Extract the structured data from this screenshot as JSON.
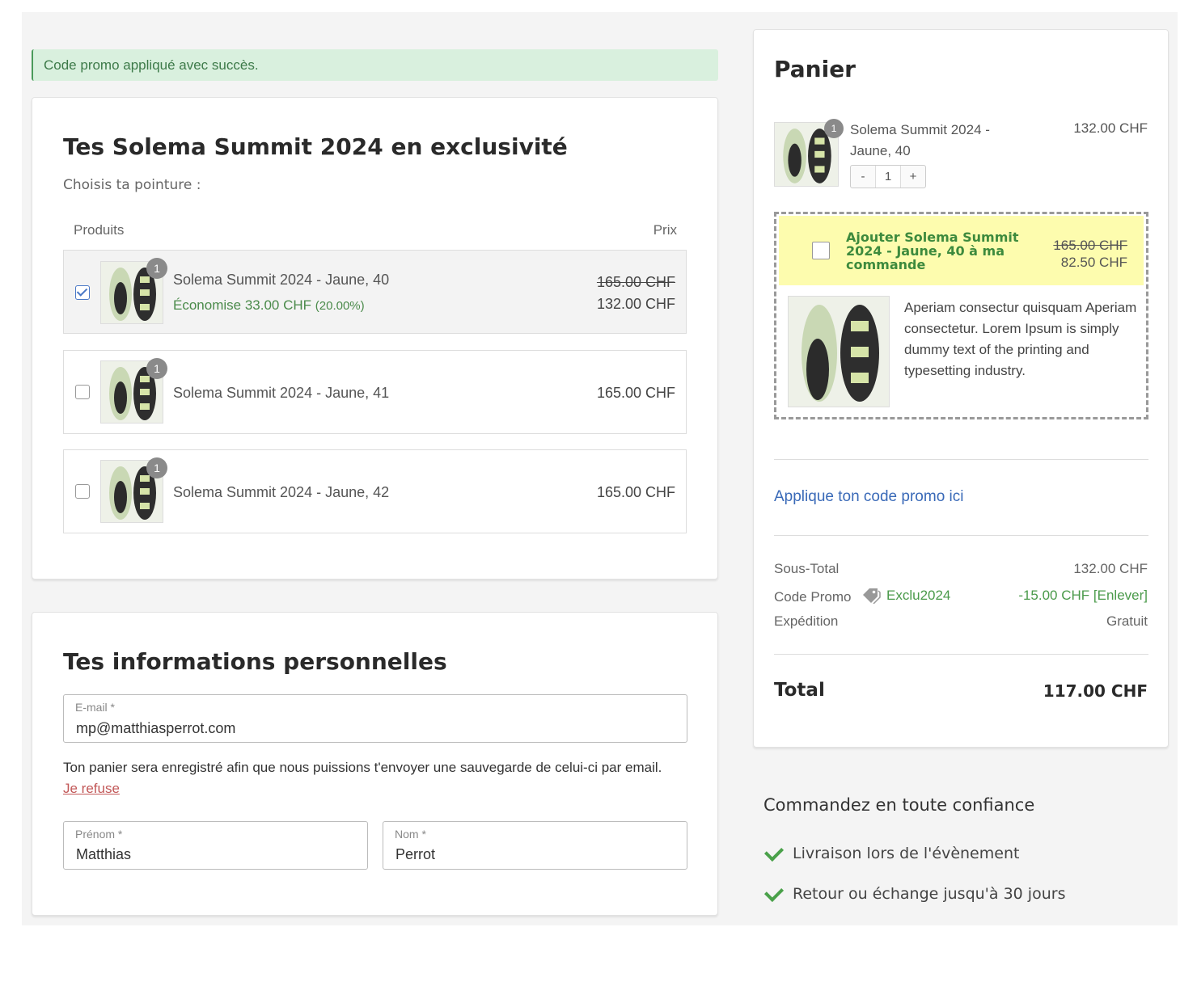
{
  "alert": {
    "text": "Code promo appliqué avec succès."
  },
  "products_section": {
    "title": "Tes Solema Summit 2024 en exclusivité",
    "subtitle": "Choisis ta pointure :",
    "col_products": "Produits",
    "col_price": "Prix",
    "rows": [
      {
        "name": "Solema Summit 2024 - Jaune, 40",
        "badge": "1",
        "checked": true,
        "old_price": "165.00 CHF",
        "price": "132.00 CHF",
        "saving": "Économise 33.00 CHF",
        "saving_pct": "(20.00%)"
      },
      {
        "name": "Solema Summit 2024 - Jaune, 41",
        "badge": "1",
        "checked": false,
        "price": "165.00 CHF"
      },
      {
        "name": "Solema Summit 2024 - Jaune, 42",
        "badge": "1",
        "checked": false,
        "price": "165.00 CHF"
      }
    ]
  },
  "personal": {
    "title": "Tes informations personnelles",
    "email": {
      "label": "E-mail  *",
      "value": "mp@matthiasperrot.com"
    },
    "note": "Ton panier sera enregistré afin que nous puissions t'envoyer une sauvegarde de celui-ci par email.",
    "refuse": "Je refuse",
    "firstname": {
      "label": "Prénom *",
      "value": "Matthias"
    },
    "lastname": {
      "label": "Nom *",
      "value": "Perrot"
    }
  },
  "cart": {
    "title": "Panier",
    "item": {
      "name": "Solema Summit 2024 - Jaune, 40",
      "badge": "1",
      "price": "132.00 CHF",
      "qty": "1",
      "minus": "-",
      "plus": "+"
    },
    "upsell": {
      "title": "Ajouter Solema Summit 2024 - Jaune, 40 à ma commande",
      "old_price": "165.00 CHF",
      "price": "82.50 CHF",
      "description": "Aperiam consectur quisquam Aperiam consectetur. Lorem Ipsum is simply dummy text of the printing and typesetting industry."
    },
    "promo_link": "Applique ton code promo ici",
    "subtotal_label": "Sous-Total",
    "subtotal_value": "132.00 CHF",
    "promo_label": "Code Promo",
    "promo_code": "Exclu2024",
    "promo_value": "-15.00 CHF [Enlever]",
    "shipping_label": "Expédition",
    "shipping_value": "Gratuit",
    "total_label": "Total",
    "total_value": "117.00 CHF"
  },
  "trust": {
    "title": "Commandez en toute confiance",
    "items": [
      "Livraison lors de l'évènement",
      "Retour ou échange jusqu'à 30 jours"
    ]
  },
  "colors": {
    "accent_green": "#4a9a4a",
    "link_blue": "#3a6ab8",
    "upsell_yellow": "#fdfcae",
    "alert_bg": "#d9f0de"
  },
  "icons": [
    "checkbox-icon",
    "tag-icon",
    "check-icon"
  ]
}
